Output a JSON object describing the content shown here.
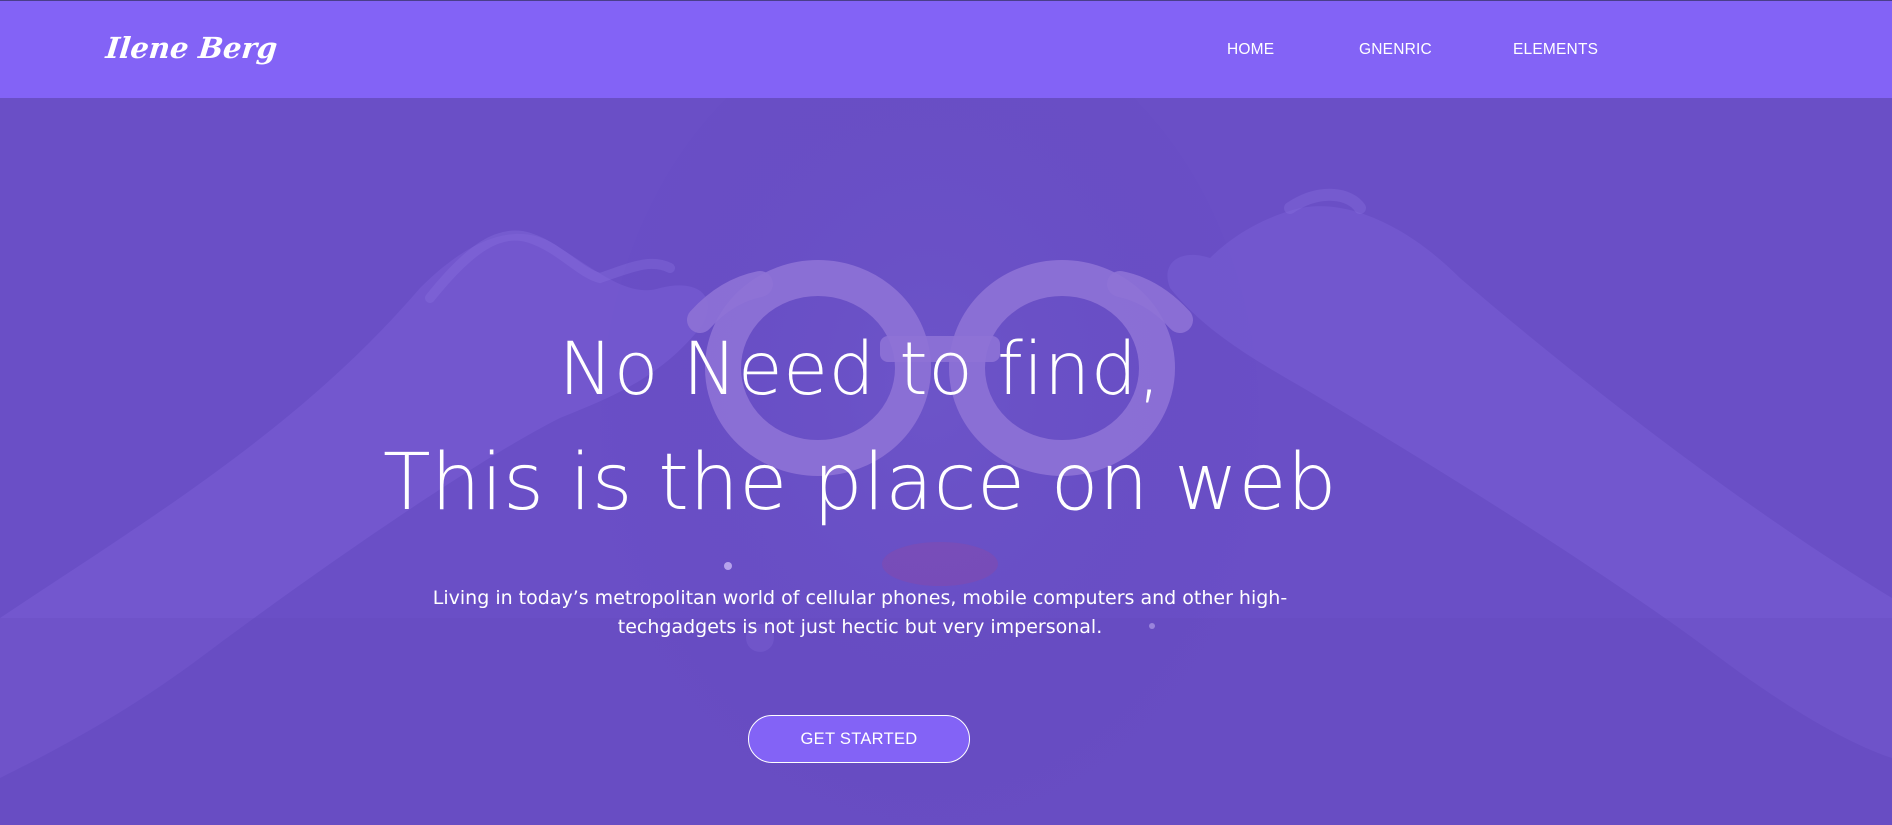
{
  "header": {
    "logo": "Ilene Berg",
    "nav": [
      {
        "label": "HOME"
      },
      {
        "label": "GNENRIC"
      },
      {
        "label": "ELEMENTS"
      }
    ],
    "background_color": "#8363f6"
  },
  "hero": {
    "headline_line_1": "No Need to find,",
    "headline_line_2": "This is the place on web",
    "subtext": "Living in today’s metropolitan world of cellular phones, mobile computers and other high-techgadgets is not just hectic but very impersonal.",
    "cta_label": "GET STARTED",
    "overlay_color": "#6a4fc6",
    "background_image_description_icon": "woman-with-glasses-photo"
  }
}
